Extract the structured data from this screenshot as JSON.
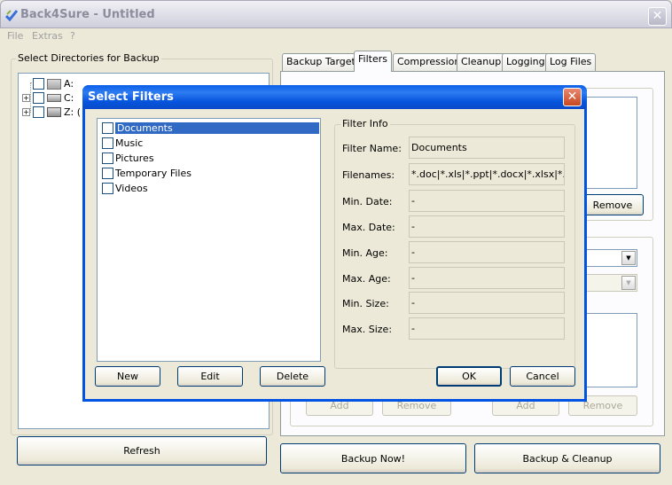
{
  "window": {
    "title": "Back4Sure - Untitled",
    "close_glyph": "✕"
  },
  "menu": [
    "File",
    "Extras",
    "?"
  ],
  "left_panel": {
    "group_label": "Select Directories for Backup",
    "tree": [
      {
        "label": "A:",
        "icon": "floppy-drive-icon"
      },
      {
        "label": "C:",
        "icon": "hard-drive-icon"
      },
      {
        "label": "Z: (",
        "icon": "network-drive-icon"
      }
    ],
    "refresh_label": "Refresh"
  },
  "tabs": [
    "Backup Target",
    "Filters",
    "Compression",
    "Cleanup",
    "Logging",
    "Log Files"
  ],
  "active_tab": "Filters",
  "filters_page": {
    "remove_label": "Remove",
    "add_label_1": "Add",
    "remove_label_2": "Remove",
    "add_label_2": "Add",
    "remove_label_3": "Remove"
  },
  "bottom_buttons": {
    "backup_now": "Backup Now!",
    "backup_cleanup": "Backup & Cleanup"
  },
  "dialog": {
    "title": "Select Filters",
    "close_glyph": "✕",
    "filters": [
      {
        "label": "Documents",
        "checked": false,
        "selected": true
      },
      {
        "label": "Music",
        "checked": false,
        "selected": false
      },
      {
        "label": "Pictures",
        "checked": false,
        "selected": false
      },
      {
        "label": "Temporary Files",
        "checked": false,
        "selected": false
      },
      {
        "label": "Videos",
        "checked": false,
        "selected": false
      }
    ],
    "filter_info": {
      "group_label": "Filter Info",
      "fields": [
        {
          "label": "Filter Name:",
          "value": "Documents"
        },
        {
          "label": "Filenames:",
          "value": "*.doc|*.xls|*.ppt|*.docx|*.xlsx|*.p"
        },
        {
          "label": "Min. Date:",
          "value": "-"
        },
        {
          "label": "Max. Date:",
          "value": "-"
        },
        {
          "label": "Min. Age:",
          "value": "-"
        },
        {
          "label": "Max. Age:",
          "value": "-"
        },
        {
          "label": "Min. Size:",
          "value": "-"
        },
        {
          "label": "Max. Size:",
          "value": "-"
        }
      ]
    },
    "buttons": {
      "new": "New",
      "edit": "Edit",
      "delete": "Delete",
      "ok": "OK",
      "cancel": "Cancel"
    }
  }
}
